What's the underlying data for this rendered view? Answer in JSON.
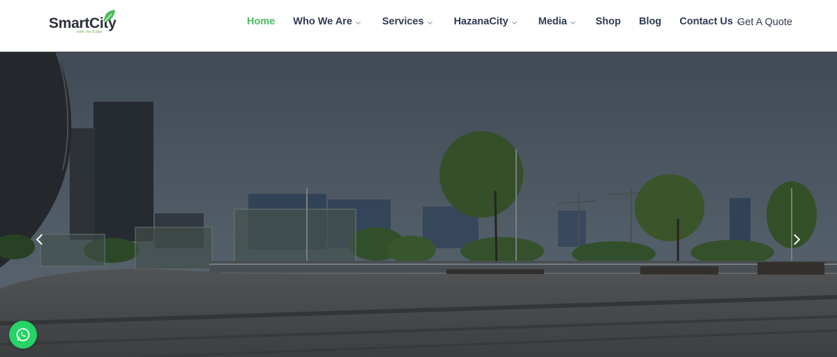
{
  "brand": {
    "name": "SmartCity",
    "tagline": "work. live & play",
    "accent_color": "#4dbb5f"
  },
  "nav": {
    "items": [
      {
        "label": "Home",
        "active": true,
        "dropdown": false
      },
      {
        "label": "Who We Are",
        "active": false,
        "dropdown": true
      },
      {
        "label": "Services",
        "active": false,
        "dropdown": true
      },
      {
        "label": "HazanaCity",
        "active": false,
        "dropdown": true
      },
      {
        "label": "Media",
        "active": false,
        "dropdown": true
      },
      {
        "label": "Shop",
        "active": false,
        "dropdown": false
      },
      {
        "label": "Blog",
        "active": false,
        "dropdown": false
      },
      {
        "label": "Contact Us",
        "active": false,
        "dropdown": true
      }
    ],
    "cta_label": "Get A Quote"
  },
  "hero": {
    "prev_icon": "chevron-left-icon",
    "next_icon": "chevron-right-icon"
  },
  "floating": {
    "whatsapp_icon": "whatsapp-icon",
    "whatsapp_color": "#25d366"
  }
}
